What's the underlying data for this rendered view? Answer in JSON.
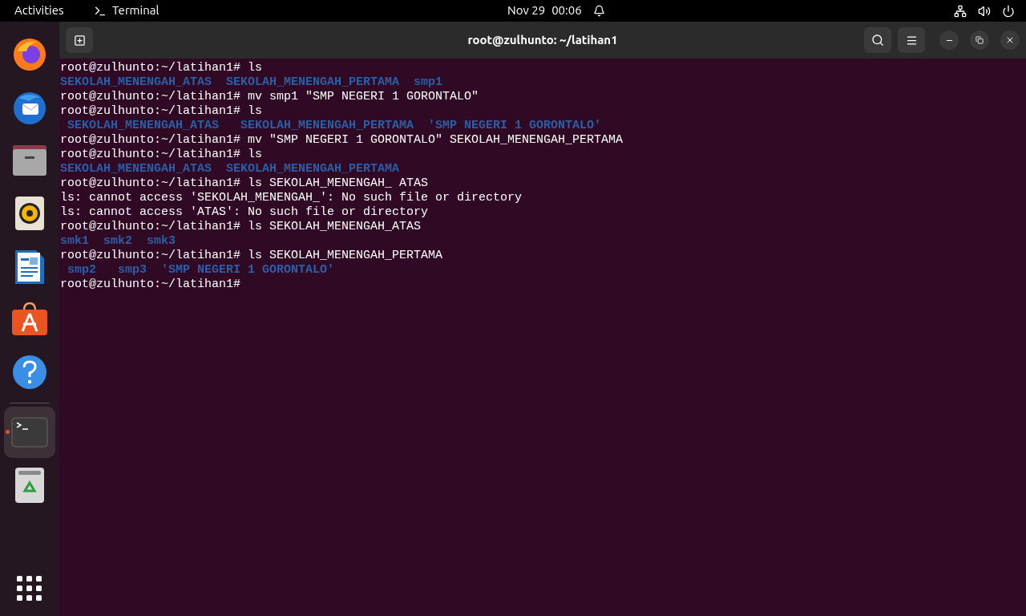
{
  "top_bar": {
    "activities": "Activities",
    "app_name": "Terminal",
    "date": "Nov 29",
    "time": "00:06"
  },
  "dock": {
    "items": [
      {
        "kind": "browser",
        "selected": false
      },
      {
        "kind": "mail",
        "selected": false
      },
      {
        "kind": "files",
        "selected": false
      },
      {
        "kind": "music",
        "selected": false
      },
      {
        "kind": "writer",
        "selected": false
      },
      {
        "kind": "store",
        "selected": false
      },
      {
        "kind": "help",
        "selected": false
      },
      {
        "kind": "terminal",
        "selected": true
      },
      {
        "kind": "trash",
        "selected": false
      }
    ]
  },
  "window": {
    "title": "root@zulhunto: ~/latihan1"
  },
  "terminal": {
    "lines": [
      {
        "kind": "command",
        "text": "root@zulhunto:~/latihan1# ls"
      },
      {
        "kind": "listing",
        "text": "SEKOLAH_MENENGAH_ATAS  SEKOLAH_MENENGAH_PERTAMA  smp1"
      },
      {
        "kind": "command",
        "text": "root@zulhunto:~/latihan1# mv smp1 \"SMP NEGERI 1 GORONTALO\""
      },
      {
        "kind": "command",
        "text": "root@zulhunto:~/latihan1# ls"
      },
      {
        "kind": "listing",
        "text": " SEKOLAH_MENENGAH_ATAS   SEKOLAH_MENENGAH_PERTAMA  'SMP NEGERI 1 GORONTALO'"
      },
      {
        "kind": "command",
        "text": "root@zulhunto:~/latihan1# mv \"SMP NEGERI 1 GORONTALO\" SEKOLAH_MENENGAH_PERTAMA"
      },
      {
        "kind": "command",
        "text": "root@zulhunto:~/latihan1# ls"
      },
      {
        "kind": "listing",
        "text": "SEKOLAH_MENENGAH_ATAS  SEKOLAH_MENENGAH_PERTAMA"
      },
      {
        "kind": "command",
        "text": "root@zulhunto:~/latihan1# ls SEKOLAH_MENENGAH_ ATAS"
      },
      {
        "kind": "output",
        "text": "ls: cannot access 'SEKOLAH_MENENGAH_': No such file or directory"
      },
      {
        "kind": "output",
        "text": "ls: cannot access 'ATAS': No such file or directory"
      },
      {
        "kind": "command",
        "text": "root@zulhunto:~/latihan1# ls SEKOLAH_MENENGAH_ATAS"
      },
      {
        "kind": "listing",
        "text": "smk1  smk2  smk3"
      },
      {
        "kind": "command",
        "text": "root@zulhunto:~/latihan1# ls SEKOLAH_MENENGAH_PERTAMA"
      },
      {
        "kind": "listing",
        "text": " smp2   smp3  'SMP NEGERI 1 GORONTALO'"
      },
      {
        "kind": "command",
        "text": "root@zulhunto:~/latihan1#"
      }
    ]
  }
}
